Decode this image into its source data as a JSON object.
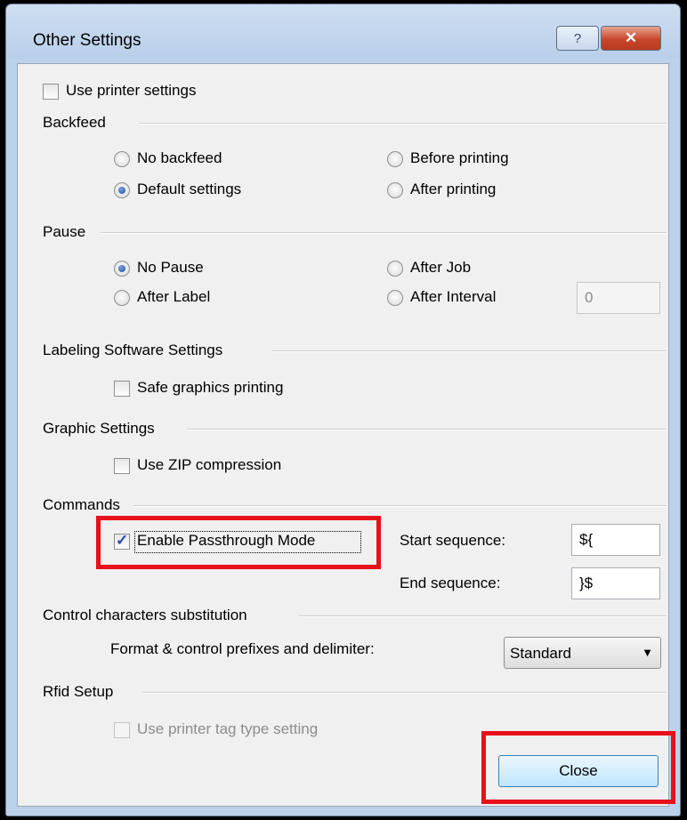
{
  "dialog": {
    "title": "Other Settings",
    "help_button": "?",
    "close_button": "✕"
  },
  "use_printer_settings": {
    "label": "Use printer settings",
    "checked": false
  },
  "backfeed": {
    "heading": "Backfeed",
    "options": [
      {
        "label": "No backfeed",
        "selected": false
      },
      {
        "label": "Default settings",
        "selected": true
      },
      {
        "label": "Before printing",
        "selected": false
      },
      {
        "label": "After printing",
        "selected": false
      }
    ]
  },
  "pause": {
    "heading": "Pause",
    "options": [
      {
        "label": "No Pause",
        "selected": true
      },
      {
        "label": "After Label",
        "selected": false
      },
      {
        "label": "After Job",
        "selected": false
      },
      {
        "label": "After Interval",
        "selected": false
      }
    ],
    "interval_value": "0"
  },
  "labeling_software": {
    "heading": "Labeling Software Settings",
    "safe_graphics": {
      "label": "Safe graphics printing",
      "checked": false
    }
  },
  "graphic_settings": {
    "heading": "Graphic Settings",
    "zip": {
      "label": "Use ZIP compression",
      "checked": false
    }
  },
  "commands": {
    "heading": "Commands",
    "passthrough": {
      "label": "Enable Passthrough Mode",
      "checked": true
    },
    "start_label": "Start sequence:",
    "start_value": "${",
    "end_label": "End sequence:",
    "end_value": "}$"
  },
  "control_chars": {
    "heading": "Control characters substitution",
    "format_label": "Format & control prefixes and delimiter:",
    "format_value": "Standard"
  },
  "rfid": {
    "heading": "Rfid Setup",
    "tag_type": {
      "label": "Use printer tag type setting",
      "checked": false,
      "enabled": false
    }
  },
  "footer": {
    "close_label": "Close"
  },
  "highlight_color": "#e8101b"
}
